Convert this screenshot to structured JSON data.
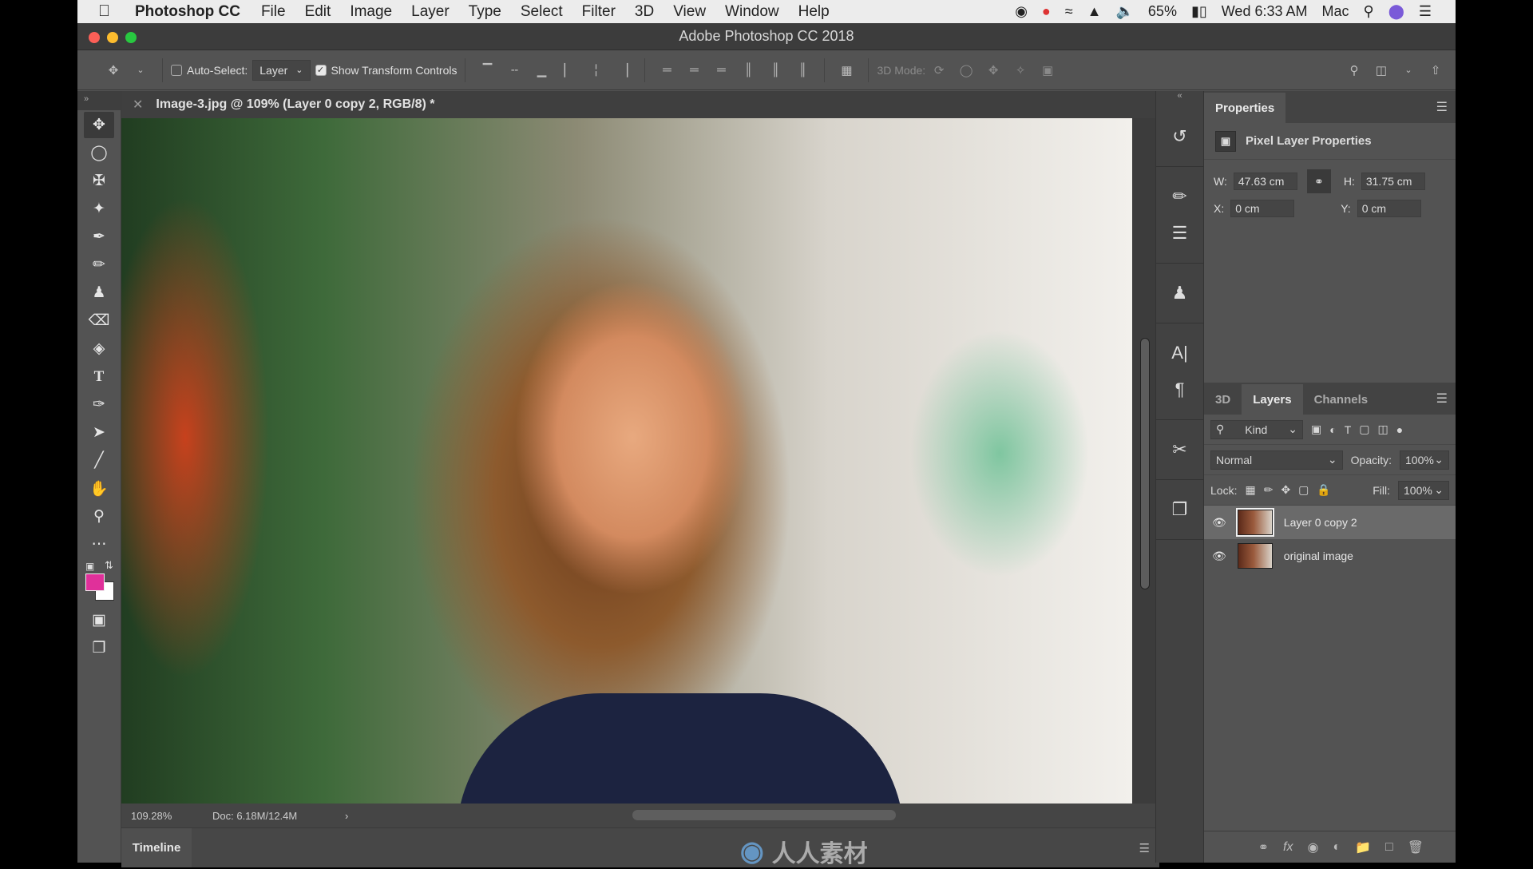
{
  "menubar": {
    "app": "Photoshop CC",
    "items": [
      "File",
      "Edit",
      "Image",
      "Layer",
      "Type",
      "Select",
      "Filter",
      "3D",
      "View",
      "Window",
      "Help"
    ],
    "battery": "65%",
    "clock": "Wed 6:33 AM",
    "user": "Mac"
  },
  "window": {
    "title": "Adobe Photoshop CC 2018"
  },
  "options": {
    "auto_select_label": "Auto-Select:",
    "auto_select_checked": false,
    "auto_select_target": "Layer",
    "show_transform_label": "Show Transform Controls",
    "show_transform_checked": true,
    "mode_3d_label": "3D Mode:"
  },
  "document": {
    "tab_title": "Image-3.jpg @ 109% (Layer 0 copy 2, RGB/8) *",
    "zoom": "109.28%",
    "doc_size": "Doc: 6.18M/12.4M"
  },
  "tools": [
    "move",
    "elliptical-marquee",
    "polygonal-lasso",
    "magic-wand",
    "eyedropper",
    "brush",
    "clone-stamp",
    "eraser",
    "paint-bucket",
    "type",
    "pen",
    "path-selection",
    "line",
    "hand",
    "zoom",
    "more"
  ],
  "colors": {
    "foreground": "#e0309a",
    "background": "#ffffff"
  },
  "timeline": {
    "label": "Timeline"
  },
  "watermark": "人人素材",
  "properties": {
    "tab": "Properties",
    "header": "Pixel Layer Properties",
    "w_label": "W:",
    "w": "47.63 cm",
    "h_label": "H:",
    "h": "31.75 cm",
    "x_label": "X:",
    "x": "0 cm",
    "y_label": "Y:",
    "y": "0 cm"
  },
  "layers_panel": {
    "tabs": [
      "3D",
      "Layers",
      "Channels"
    ],
    "active_tab": "Layers",
    "filter": "Kind",
    "blend_mode": "Normal",
    "opacity_label": "Opacity:",
    "opacity": "100%",
    "lock_label": "Lock:",
    "fill_label": "Fill:",
    "fill": "100%",
    "layers": [
      {
        "name": "Layer 0 copy 2",
        "visible": true,
        "selected": true
      },
      {
        "name": "original image",
        "visible": true,
        "selected": false
      }
    ]
  }
}
